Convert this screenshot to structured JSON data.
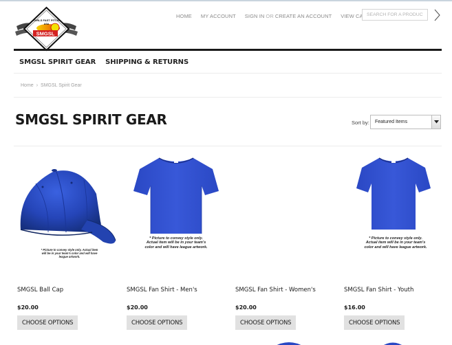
{
  "logo": {
    "line1": "GIRLS FAST PITCH",
    "line2": "ASA",
    "line3": "SMGSL"
  },
  "top_nav": {
    "home": "HOME",
    "account": "MY ACCOUNT",
    "sign_in": "SIGN IN",
    "or": "OR",
    "create": "CREATE AN ACCOUNT",
    "view_cart": "VIEW CART"
  },
  "search": {
    "placeholder": "SEARCH FOR A PRODUCT"
  },
  "main_nav": [
    "SMGSL SPIRIT GEAR",
    "SHIPPING & RETURNS"
  ],
  "breadcrumb": {
    "home": "Home",
    "sep": "›",
    "current": "SMGSL Spirit Gear"
  },
  "page_title": "SMGSL SPIRIT GEAR",
  "sort": {
    "label": "Sort by:",
    "selected": "Featured Items"
  },
  "products": [
    {
      "name": "SMGSL Ball Cap",
      "price": "$20.00",
      "button": "CHOOSE OPTIONS",
      "caption": [
        "* Picture to convey style only.  Actual item",
        "will be in your team's color and will have",
        "league artwork."
      ]
    },
    {
      "name": "SMGSL Fan Shirt - Men's",
      "price": "$20.00",
      "button": "CHOOSE OPTIONS",
      "caption": [
        "* Picture to convey style only.",
        "Actual item will be in your team's",
        "color and will have league artwork."
      ]
    },
    {
      "name": "SMGSL Fan Shirt - Women's",
      "price": "$20.00",
      "button": "CHOOSE OPTIONS",
      "caption": []
    },
    {
      "name": "SMGSL Fan Shirt - Youth",
      "price": "$16.00",
      "button": "CHOOSE OPTIONS",
      "caption": [
        "* Picture to convey style only.",
        "Actual item will be in your team's",
        "color and will have league artwork."
      ]
    }
  ],
  "colors": {
    "product_blue": "#2f4fc4",
    "accent_orange": "#e8a000",
    "rule": "#1a1a1a"
  }
}
